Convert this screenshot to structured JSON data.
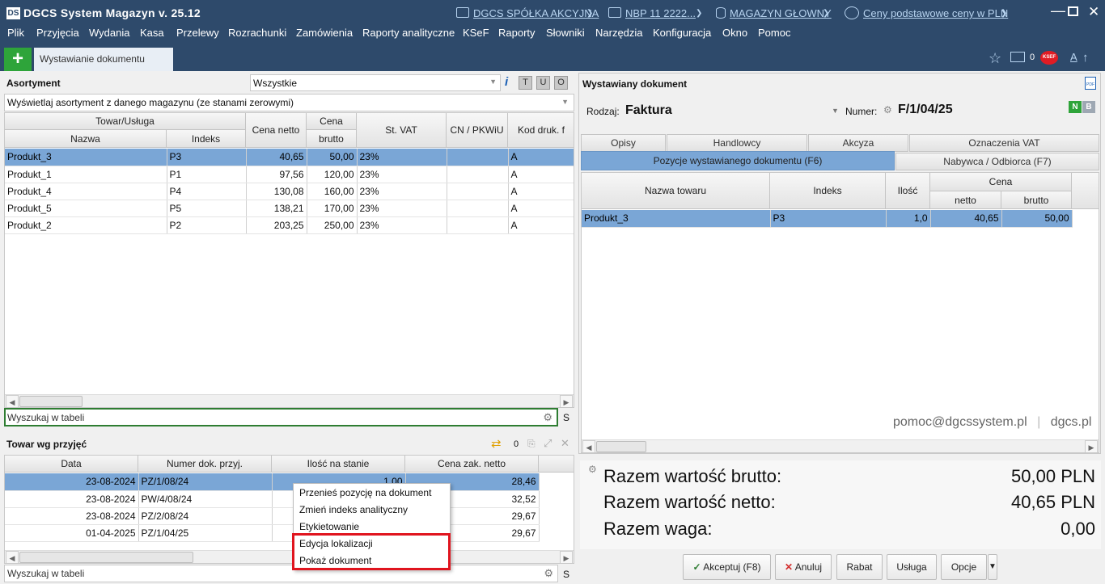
{
  "app": {
    "logo": "DS",
    "title": "DGCS System Magazyn v. 25.12",
    "company": "DGCS SPÓŁKA AKCYJNA",
    "bank": "NBP 11 2222...",
    "warehouse": "MAGAZYN GŁOWNY",
    "prices": "Ceny podstawowe ceny w PLN"
  },
  "menu": [
    {
      "label": "Plik"
    },
    {
      "label": "Przyjęcia"
    },
    {
      "label": "Wydania"
    },
    {
      "label": "Kasa"
    },
    {
      "label": "Przelewy"
    },
    {
      "label": "Rozrachunki"
    },
    {
      "label": "Zamówienia"
    },
    {
      "label": "Raporty analityczne"
    },
    {
      "label": "KSeF"
    },
    {
      "label": "Raporty"
    },
    {
      "label": "Słowniki"
    },
    {
      "label": "Narzędzia"
    },
    {
      "label": "Konfiguracja"
    },
    {
      "label": "Okno"
    },
    {
      "label": "Pomoc"
    }
  ],
  "tabs": {
    "add": "+",
    "doc_tab": "Wystawianie dokumentu",
    "counter": "0",
    "ksef": "KSEF",
    "font_label": "A"
  },
  "assortment": {
    "title": "Asortyment",
    "filter": "Wszystkie",
    "info": "i",
    "btn_t": "T",
    "btn_u": "U",
    "btn_o": "O",
    "mode": "Wyświetlaj asortyment z danego magazynu (ze stanami zerowymi)",
    "headers": {
      "group": "Towar/Usługa",
      "name": "Nazwa",
      "index": "Indeks",
      "net": "Cena netto",
      "price_group": "Cena",
      "gross": "brutto",
      "vat": "St. VAT",
      "cn": "CN / PKWiU",
      "code": "Kod druk. f"
    },
    "rows": [
      {
        "name": "Produkt_3",
        "index": "P3",
        "net": "40,65",
        "gross": "50,00",
        "vat": "23%",
        "cn": "",
        "code": "A"
      },
      {
        "name": "Produkt_1",
        "index": "P1",
        "net": "97,56",
        "gross": "120,00",
        "vat": "23%",
        "cn": "",
        "code": "A"
      },
      {
        "name": "Produkt_4",
        "index": "P4",
        "net": "130,08",
        "gross": "160,00",
        "vat": "23%",
        "cn": "",
        "code": "A"
      },
      {
        "name": "Produkt_5",
        "index": "P5",
        "net": "138,21",
        "gross": "170,00",
        "vat": "23%",
        "cn": "",
        "code": "A"
      },
      {
        "name": "Produkt_2",
        "index": "P2",
        "net": "203,25",
        "gross": "250,00",
        "vat": "23%",
        "cn": "",
        "code": "A"
      }
    ],
    "search_placeholder": "Wyszukaj w tabeli",
    "s_btn": "S"
  },
  "receipts": {
    "title": "Towar wg przyjęć",
    "count": "0",
    "headers": {
      "date": "Data",
      "doc": "Numer dok. przyj.",
      "qty": "Ilość na stanie",
      "cost": "Cena zak. netto"
    },
    "rows": [
      {
        "date": "23-08-2024",
        "doc": "PZ/1/08/24",
        "qty": "1,00",
        "cost": "28,46"
      },
      {
        "date": "23-08-2024",
        "doc": "PW/4/08/24",
        "qty": "",
        "cost": "32,52"
      },
      {
        "date": "23-08-2024",
        "doc": "PZ/2/08/24",
        "qty": "",
        "cost": "29,67"
      },
      {
        "date": "01-04-2025",
        "doc": "PZ/1/04/25",
        "qty": "",
        "cost": "29,67"
      }
    ],
    "search_placeholder": "Wyszukaj w tabeli",
    "s_btn": "S"
  },
  "context_menu": {
    "items": [
      {
        "label": "Przenieś pozycję na dokument"
      },
      {
        "label": "Zmień indeks analityczny"
      },
      {
        "label": "Etykietowanie"
      },
      {
        "label": "Edycja lokalizacji"
      },
      {
        "label": "Pokaż dokument"
      }
    ],
    "highlight_color": "#e0141e"
  },
  "document": {
    "title": "Wystawiany dokument",
    "kind_label": "Rodzaj:",
    "kind": "Faktura",
    "number_label": "Numer:",
    "number": "F/1/04/25",
    "badge_n": "N",
    "badge_b": "B",
    "tabs_row1": [
      "Opisy",
      "Handlowcy",
      "Akcyza",
      "Oznaczenia VAT"
    ],
    "tab_active": "Pozycje wystawianego dokumentu (F6)",
    "tab_buyer": "Nabywca / Odbiorca (F7)",
    "headers": {
      "name": "Nazwa towaru",
      "index": "Indeks",
      "qty": "Ilość",
      "price_group": "Cena",
      "net": "netto",
      "gross": "brutto"
    },
    "rows": [
      {
        "name": "Produkt_3",
        "index": "P3",
        "qty": "1,0",
        "net": "40,65",
        "gross": "50,00"
      }
    ],
    "watermark_email": "pomoc@dgcssystem.pl",
    "watermark_sep": "|",
    "watermark_site": "dgcs.pl",
    "totals": [
      {
        "label": "Razem wartość brutto:",
        "value": "50,00 PLN"
      },
      {
        "label": "Razem wartość netto:",
        "value": "40,65 PLN"
      },
      {
        "label": "Razem waga:",
        "value": "0,00"
      }
    ],
    "buttons": {
      "accept": "Akceptuj (F8)",
      "cancel": "Anuluj",
      "discount": "Rabat",
      "service": "Usługa",
      "options": "Opcje"
    }
  },
  "colors": {
    "accent": "#2e4a6b",
    "selection": "#7aa6d6",
    "add_button": "#2ea43a",
    "link": "#b8d4f0"
  }
}
